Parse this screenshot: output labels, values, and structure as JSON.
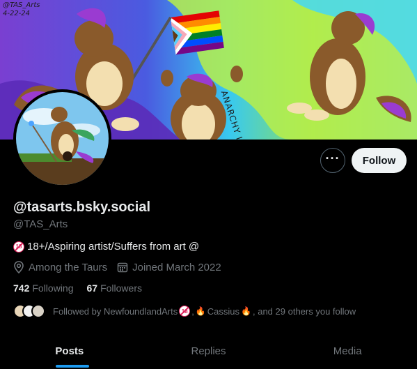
{
  "banner": {
    "signature_line1": "@TAS_Arts",
    "signature_line2": "4-22-24",
    "text": "ANARCHY IS EPIC!!"
  },
  "header": {
    "more_icon": "ellipsis-icon",
    "follow_label": "Follow"
  },
  "profile": {
    "display_name": "@tasarts.bsky.social",
    "handle": "@TAS_Arts",
    "bio_badge": "18",
    "bio_text": "18+/Aspiring artist/Suffers from art @",
    "location": "Among the Taurs",
    "joined": "Joined March 2022",
    "following_count": "742",
    "following_label": "Following",
    "followers_count": "67",
    "followers_label": "Followers",
    "followed_by_prefix": "Followed by NewfoundlandArts",
    "followed_by_mid": ",",
    "followed_by_name2": "Cassius",
    "followed_by_suffix": ", and 29 others you follow"
  },
  "tabs": [
    {
      "label": "Posts",
      "active": true
    },
    {
      "label": "Replies",
      "active": false
    },
    {
      "label": "Media",
      "active": false
    }
  ],
  "colors": {
    "background": "#000000",
    "accent": "#1d9bf0",
    "muted": "#71767b",
    "text": "#e7e9ea"
  }
}
